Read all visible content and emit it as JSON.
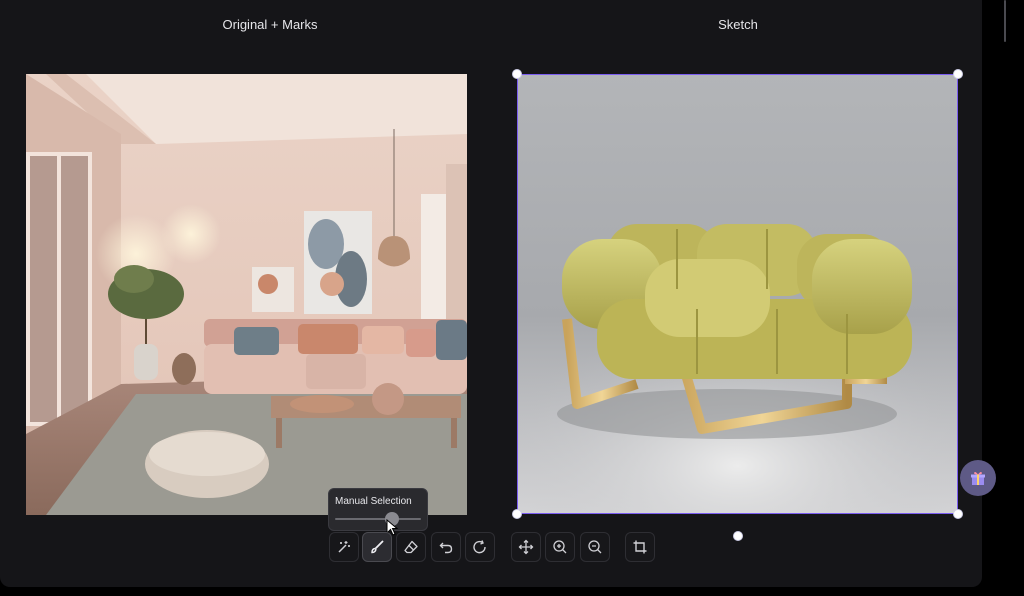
{
  "panels": {
    "left_title": "Original + Marks",
    "right_title": "Sketch"
  },
  "tooltip": {
    "label": "Manual Selection",
    "slider_value": 0.66
  },
  "toolbar": {
    "buttons": [
      {
        "name": "magic-select-button",
        "icon": "wand-icon",
        "active": false
      },
      {
        "name": "brush-button",
        "icon": "brush-icon",
        "active": true
      },
      {
        "name": "eraser-button",
        "icon": "eraser-icon",
        "active": false
      },
      {
        "name": "undo-button",
        "icon": "undo-icon",
        "active": false
      },
      {
        "name": "redo-button",
        "icon": "redo-icon",
        "active": false
      },
      {
        "name": "move-button",
        "icon": "move-icon",
        "active": false
      },
      {
        "name": "zoom-in-button",
        "icon": "zoom-in-icon",
        "active": false
      },
      {
        "name": "zoom-out-button",
        "icon": "zoom-out-icon",
        "active": false
      },
      {
        "name": "crop-button",
        "icon": "crop-icon",
        "active": false
      }
    ]
  },
  "colors": {
    "background": "#151518",
    "selection": "#7a5cf0",
    "gift_bg": "#5e5a86"
  }
}
